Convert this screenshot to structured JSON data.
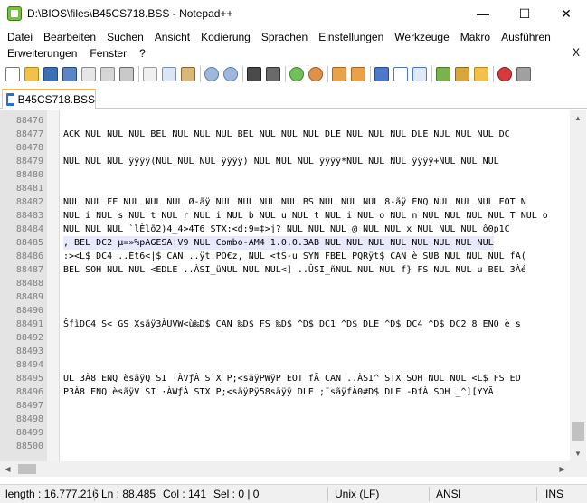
{
  "window": {
    "title": "D:\\BIOS\\files\\B45CS718.BSS - Notepad++",
    "minimize": "—",
    "maximize": "☐",
    "close": "✕"
  },
  "menu": {
    "row1": [
      "Datei",
      "Bearbeiten",
      "Suchen",
      "Ansicht",
      "Kodierung",
      "Sprachen",
      "Einstellungen",
      "Werkzeuge",
      "Makro",
      "Ausführen"
    ],
    "row2": [
      "Erweiterungen",
      "Fenster",
      "?"
    ],
    "close_doc": "X"
  },
  "toolbar": {
    "icons": [
      "new-file-icon",
      "open-file-icon",
      "save-icon",
      "save-all-icon",
      "close-icon",
      "close-all-icon",
      "print-icon",
      "sep",
      "cut-icon",
      "copy-icon",
      "paste-icon",
      "sep",
      "undo-icon",
      "redo-icon",
      "sep",
      "find-icon",
      "replace-icon",
      "sep",
      "zoom-in-icon",
      "zoom-out-icon",
      "sep",
      "sync-vertical-icon",
      "sync-horizontal-icon",
      "sep",
      "word-wrap-icon",
      "show-all-chars-icon",
      "indent-guide-icon",
      "sep",
      "doc-map-icon",
      "function-list-icon",
      "folder-workspace-icon",
      "sep",
      "record-macro-icon",
      "stop-macro-icon"
    ]
  },
  "tab": {
    "label": "B45CS718.BSS"
  },
  "editor": {
    "lines": [
      {
        "num": "88476",
        "text": ""
      },
      {
        "num": "88477",
        "text": "ACK NUL NUL NUL BEL NUL NUL NUL BEL NUL NUL NUL DLE NUL NUL NUL DLE NUL NUL NUL DC"
      },
      {
        "num": "88478",
        "text": ""
      },
      {
        "num": "88479",
        "text": " NUL NUL NUL ÿÿÿÿ(NUL NUL NUL ÿÿÿÿ) NUL NUL NUL ÿÿÿÿ*NUL NUL NUL ÿÿÿÿ+NUL NUL NUL"
      },
      {
        "num": "88480",
        "text": ""
      },
      {
        "num": "88481",
        "text": ""
      },
      {
        "num": "88482",
        "text": "NUL NUL FF NUL NUL NUL Ø-ãÿ NUL NUL NUL NUL BS NUL NUL NUL 8-ãÿ ENQ NUL NUL NUL EOT N"
      },
      {
        "num": "88483",
        "text": "NUL i NUL s NUL t NUL r NUL i NUL b NUL u NUL t NUL i NUL o NUL n NUL NUL NUL NUL T NUL o"
      },
      {
        "num": "88484",
        "text": " NUL NUL NUL `lÈlõ2)4_4>4T6 STX:<d:9=‡>j? NUL NUL NUL @ NUL NUL x NUL NUL NUL ô0p1C"
      },
      {
        "num": "88485",
        "text": ", BEL DC2 µ=»%pAGESA!V9 NUL Combo-AM4 1.0.0.3AB NUL NUL NUL NUL NUL NUL NUL NUL"
      },
      {
        "num": "88486",
        "text": ":><L$ DC4 ..Ét6<|$ CAN ..ÿt.PÒ€z, NUL <tŠ-u SYN FBEL PQRÿt$ CAN è SUB NUL NUL NUL fÃ("
      },
      {
        "num": "88487",
        "text": " BEL SOH NUL NUL <EDLE ..ÀSI_üNUL NUL NUL<] ..ÛSI_ñNUL NUL NUL f} FS NUL NUL u BEL 3Àé"
      },
      {
        "num": "88488",
        "text": ""
      },
      {
        "num": "88489",
        "text": ""
      },
      {
        "num": "88490",
        "text": ""
      },
      {
        "num": "88491",
        "text": "ŠfìDC4 S< GS Xsãÿ3ÀUVW<ù‰D$ CAN ‰D$ FS ‰D$ ^D$ DC1 ^D$ DLE ^D$ DC4 ^D$ DC2 8 ENQ è s"
      },
      {
        "num": "88492",
        "text": ""
      },
      {
        "num": "88493",
        "text": ""
      },
      {
        "num": "88494",
        "text": ""
      },
      {
        "num": "88495",
        "text": "UL 3À8 ENQ èsãÿQ SI ·ÀVƒÀ STX P;<sãÿPWÿP EOT fÃ CAN ..ÀSI^ STX SOH NUL NUL <L$ FS ED"
      },
      {
        "num": "88496",
        "text": "P3À8 ENQ èsãÿV SI ·ÀWƒÀ STX P;<sãÿPÿ58sãÿÿ DLE ;¨sãÿfÀ0#D$ DLE -ÐfÀ SOH _^][YYÃ"
      },
      {
        "num": "88497",
        "text": ""
      },
      {
        "num": "88498",
        "text": ""
      },
      {
        "num": "88499",
        "text": ""
      },
      {
        "num": "88500",
        "text": ""
      }
    ],
    "current_line": "88485"
  },
  "statusbar": {
    "length": "length : 16.777.216",
    "ln": "Ln : 88.485",
    "col": "Col : 141",
    "sel": "Sel : 0 | 0",
    "eol": "Unix (LF)",
    "encoding": "ANSI",
    "mode": "INS"
  }
}
